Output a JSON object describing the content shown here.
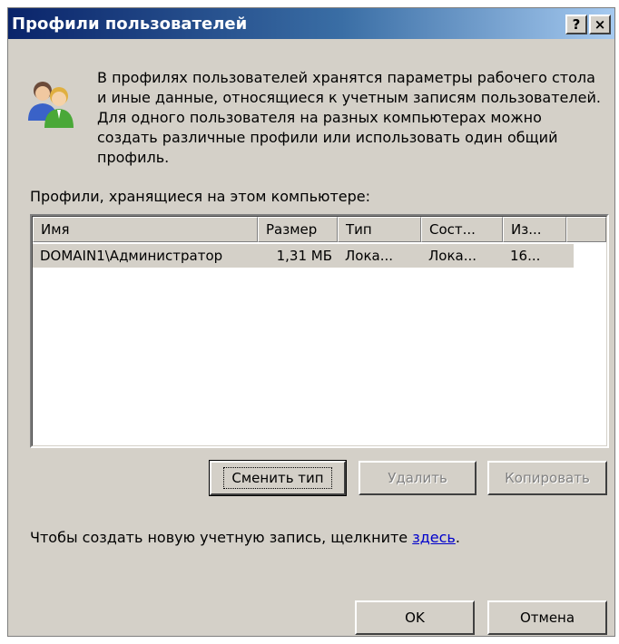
{
  "window": {
    "title": "Профили пользователей",
    "help_button": "?",
    "close_button": "×"
  },
  "description": "В профилях пользователей хранятся параметры рабочего стола и иные данные, относящиеся к учетным записям пользователей. Для одного пользователя на разных компьютерах можно создать различные профили или использовать один общий профиль.",
  "icon": "users-icon",
  "profiles_label": "Профили, хранящиеся на этом компьютере:",
  "list": {
    "columns": [
      "Имя",
      "Размер",
      "Тип",
      "Сост...",
      "Из..."
    ],
    "rows": [
      {
        "name": "DOMAIN1\\Администратор",
        "size": "1,31 МБ",
        "type": "Лока...",
        "state": "Лока...",
        "modified": "16..."
      }
    ]
  },
  "buttons": {
    "change_type": "Сменить тип",
    "delete": "Удалить",
    "copy": "Копировать",
    "ok": "OK",
    "cancel": "Отмена"
  },
  "create_account": {
    "prefix": "Чтобы создать новую учетную запись, щелкните ",
    "link": "здесь",
    "suffix": "."
  },
  "colors": {
    "dialog_bg": "#d4d0c8",
    "title_start": "#0a246a",
    "title_end": "#a6caf0",
    "link": "#0000cc",
    "disabled_text": "#808080"
  }
}
